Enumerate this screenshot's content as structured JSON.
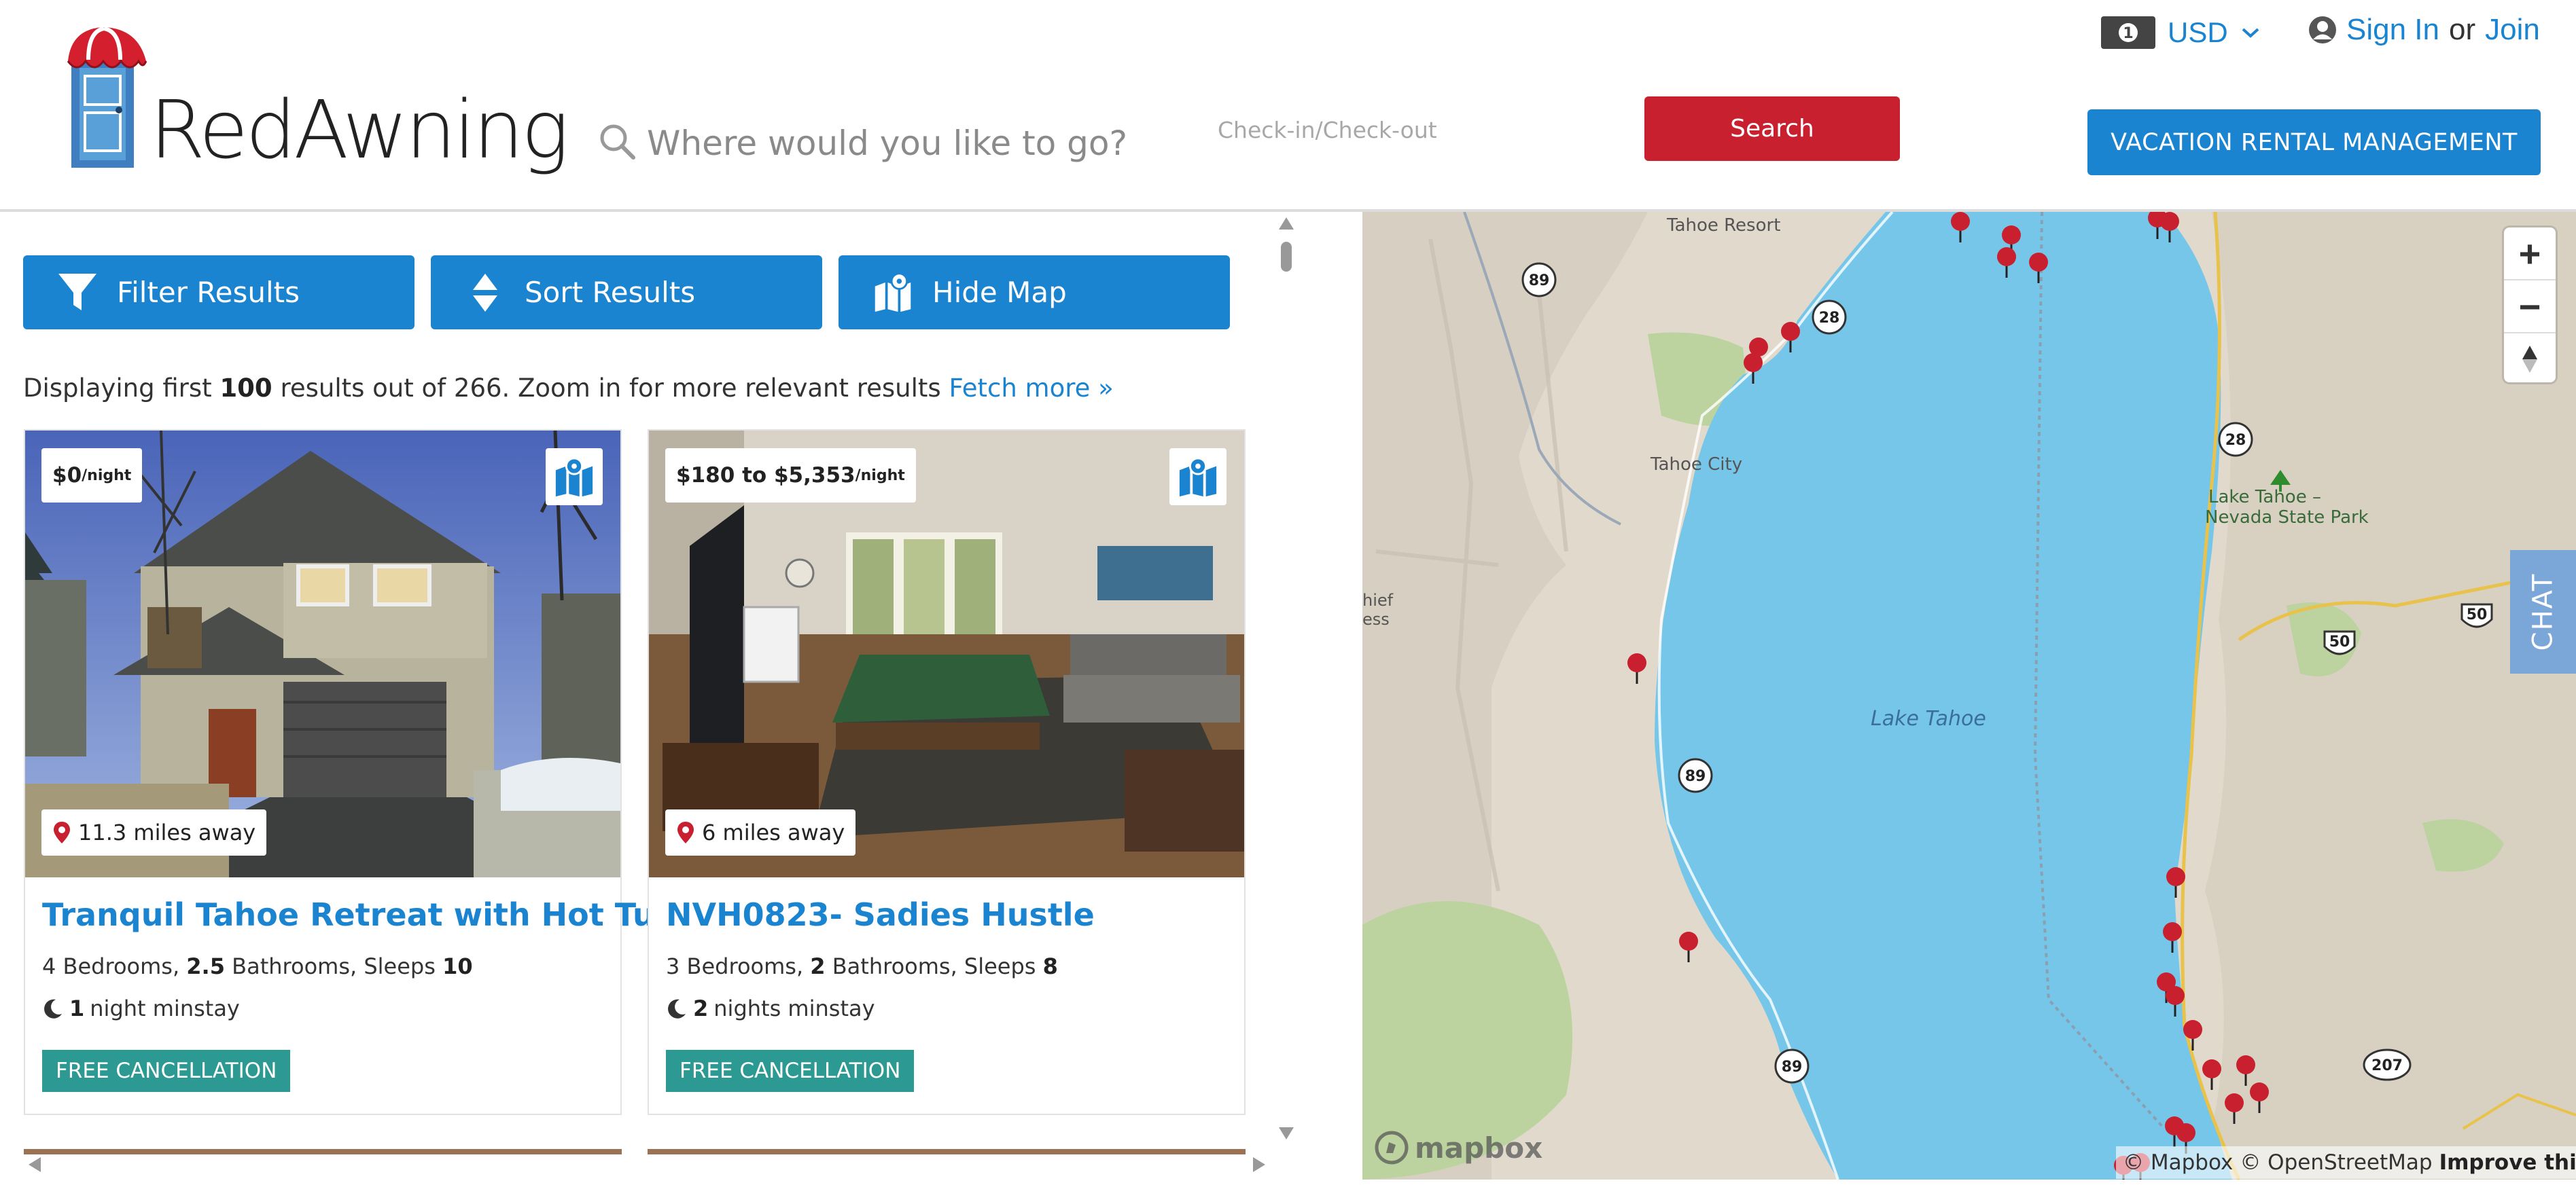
{
  "header": {
    "logo_text": "RedAwning",
    "search_placeholder": "Where would you like to go?",
    "dates_placeholder": "Check-in/Check-out",
    "search_button": "Search",
    "currency": "USD",
    "sign_in": "Sign In",
    "or": "or",
    "join": "Join",
    "vrm_button": "VACATION RENTAL MANAGEMENT"
  },
  "toolbar": {
    "filter": "Filter Results",
    "sort": "Sort Results",
    "hide_map": "Hide Map"
  },
  "results": {
    "prefix": "Displaying first",
    "shown": "100",
    "suffix": "results out of 266. Zoom in for more relevant results",
    "fetch_more": "Fetch more »"
  },
  "listings": [
    {
      "price": "$0",
      "per": "/night",
      "distance": "11.3 miles away",
      "title": "Tranquil Tahoe Retreat with Hot Tub",
      "bedrooms": "4",
      "bathrooms": "2.5",
      "sleeps": "10",
      "minstay_nights": "1",
      "minstay_label": "night minstay",
      "badge": "FREE CANCELLATION"
    },
    {
      "price": "$180 to $5,353",
      "per": "/night",
      "distance": "6 miles away",
      "title": "NVH0823- Sadies Hustle",
      "bedrooms": "3",
      "bathrooms": "2",
      "sleeps": "8",
      "minstay_nights": "2",
      "minstay_label": "nights minstay",
      "badge": "FREE CANCELLATION"
    }
  ],
  "spec_labels": {
    "bedrooms": "Bedrooms,",
    "bathrooms": "Bathrooms,",
    "sleeps": "Sleeps"
  },
  "map": {
    "places": {
      "tahoe_resort": "Tahoe Resort",
      "tahoe_city": "Tahoe City",
      "lake_tahoe": "Lake Tahoe",
      "state_park_line1": "Lake Tahoe –",
      "state_park_line2": "Nevada State Park",
      "chief_line1": "hief",
      "chief_line2": "ess"
    },
    "routes": [
      "89",
      "28",
      "89",
      "28",
      "89",
      "50",
      "50",
      "207"
    ],
    "zoom_in": "+",
    "zoom_out": "−",
    "chat": "CHAT",
    "mapbox": "mapbox",
    "attribution": {
      "mapbox": "© Mapbox",
      "osm": "© OpenStreetMap",
      "improve": "Improve this map"
    }
  },
  "colors": {
    "brand_blue": "#1a84d0",
    "brand_red": "#c8202f",
    "badge_teal": "#2c9a92",
    "lake": "#76c6ea"
  }
}
